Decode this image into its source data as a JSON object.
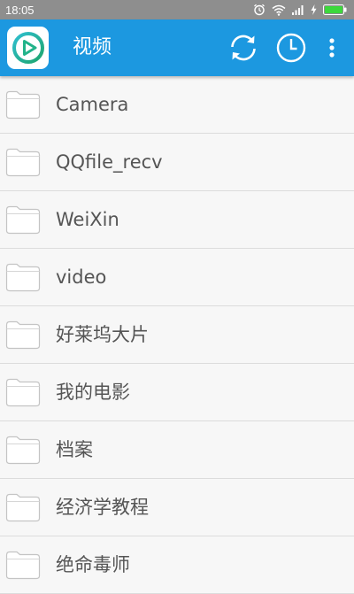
{
  "status_bar": {
    "time": "18:05",
    "icons": [
      "alarm-icon",
      "wifi-icon",
      "signal-icon",
      "charging-icon",
      "battery-icon"
    ],
    "color": "#8e8e8e",
    "battery_color": "#3cd83c"
  },
  "app_bar": {
    "title": "视频",
    "color": "#1c98e0",
    "actions": [
      "refresh-icon",
      "history-clock-icon",
      "more-vert-icon"
    ]
  },
  "folders": [
    {
      "name": "Camera"
    },
    {
      "name": "QQfile_recv"
    },
    {
      "name": "WeiXin"
    },
    {
      "name": "video"
    },
    {
      "name": "好莱坞大片"
    },
    {
      "name": "我的电影"
    },
    {
      "name": "档案"
    },
    {
      "name": "经济学教程"
    },
    {
      "name": "绝命毒师"
    }
  ]
}
